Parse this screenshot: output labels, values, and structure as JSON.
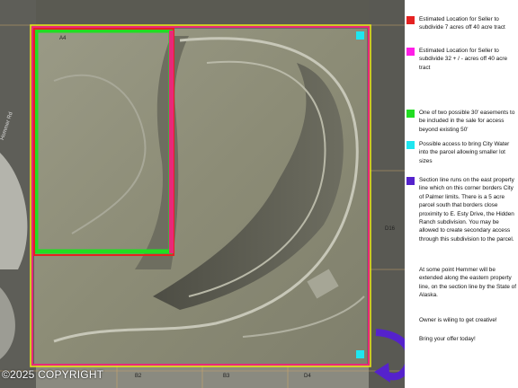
{
  "colors": {
    "red": "#e52222",
    "magenta": "#ff1ee6",
    "green": "#22dd22",
    "cyan": "#1ee6f0",
    "purple": "#5522cc",
    "yellow_boundary": "#e8e21a",
    "pink_boundary": "#e8287a"
  },
  "legend": [
    {
      "color": "#e52222",
      "icon": "red-square-icon",
      "text": "Estimated Location for Seller to subdivide 7 acres off 40 acre tract"
    },
    {
      "color": "#ff1ee6",
      "icon": "magenta-square-icon",
      "text": "Estimated Location for Seller to subdivide 32 + / - acres off 40 acre tract"
    },
    {
      "color": "#22dd22",
      "icon": "green-square-icon",
      "text": "One of two possible 30' easements to be included in the sale for access beyond existing 50'"
    },
    {
      "color": "#1ee6f0",
      "icon": "cyan-square-icon",
      "text": "Possible access to bring City Water into the parcel allowing smaller lot sizes"
    },
    {
      "color": "#5522cc",
      "icon": "purple-square-icon",
      "text": "Section line runs on the east property line which on this corner borders City of Palmer limits. There is a 5 acre parcel south that borders close proximity to E. Esty Drive, the Hidden Ranch subdivision. You may be allowed to create secondary access through this subdivision to the parcel."
    }
  ],
  "notes": [
    "At some point Hemmer will be extended along the eastern property line, on the section line by the State of Alaska.",
    "Owner is wiling to get creative!",
    "Bring your offer today!"
  ],
  "map_labels": {
    "a4": "A4",
    "b2": "B2",
    "b3": "B3",
    "d4": "D4",
    "d16": "D16",
    "road": "Hemmer Rd"
  },
  "copyright": "©2025 COPYRIGHT"
}
